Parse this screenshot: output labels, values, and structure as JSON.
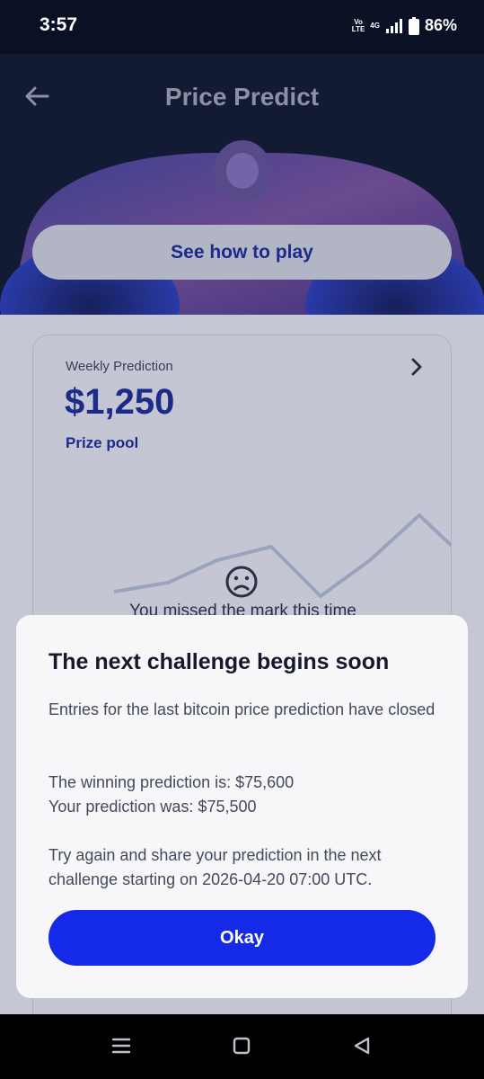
{
  "status_bar": {
    "time": "3:57",
    "volte_top": "Vo",
    "volte_bottom": "LTE",
    "network": "4G",
    "battery": "86%",
    "icons": [
      "signal-icon",
      "battery-icon"
    ]
  },
  "header": {
    "title": "Price Predict",
    "back_icon": "arrow-left-icon"
  },
  "hero": {
    "how_to_play_label": "See how to play"
  },
  "card": {
    "eyebrow": "Weekly Prediction",
    "amount": "$1,250",
    "subtitle": "Prize pool",
    "missed_text": "You missed the mark this time",
    "chevron_icon": "chevron-right-icon",
    "sad_icon": "sad-face-icon"
  },
  "modal": {
    "title": "The next challenge begins soon",
    "paragraph_1": "Entries for the last bitcoin price prediction have closed",
    "winning_line": "The winning prediction is: $75,600",
    "your_line": "Your prediction was: $75,500",
    "paragraph_3": "Try again and share your prediction in the next challenge starting on 2026-04-20 07:00 UTC.",
    "okay_label": "Okay",
    "accent_color": "#1529E8"
  },
  "nav_bar": {
    "icons": [
      "recents-icon",
      "home-icon",
      "back-triangle-icon"
    ]
  }
}
